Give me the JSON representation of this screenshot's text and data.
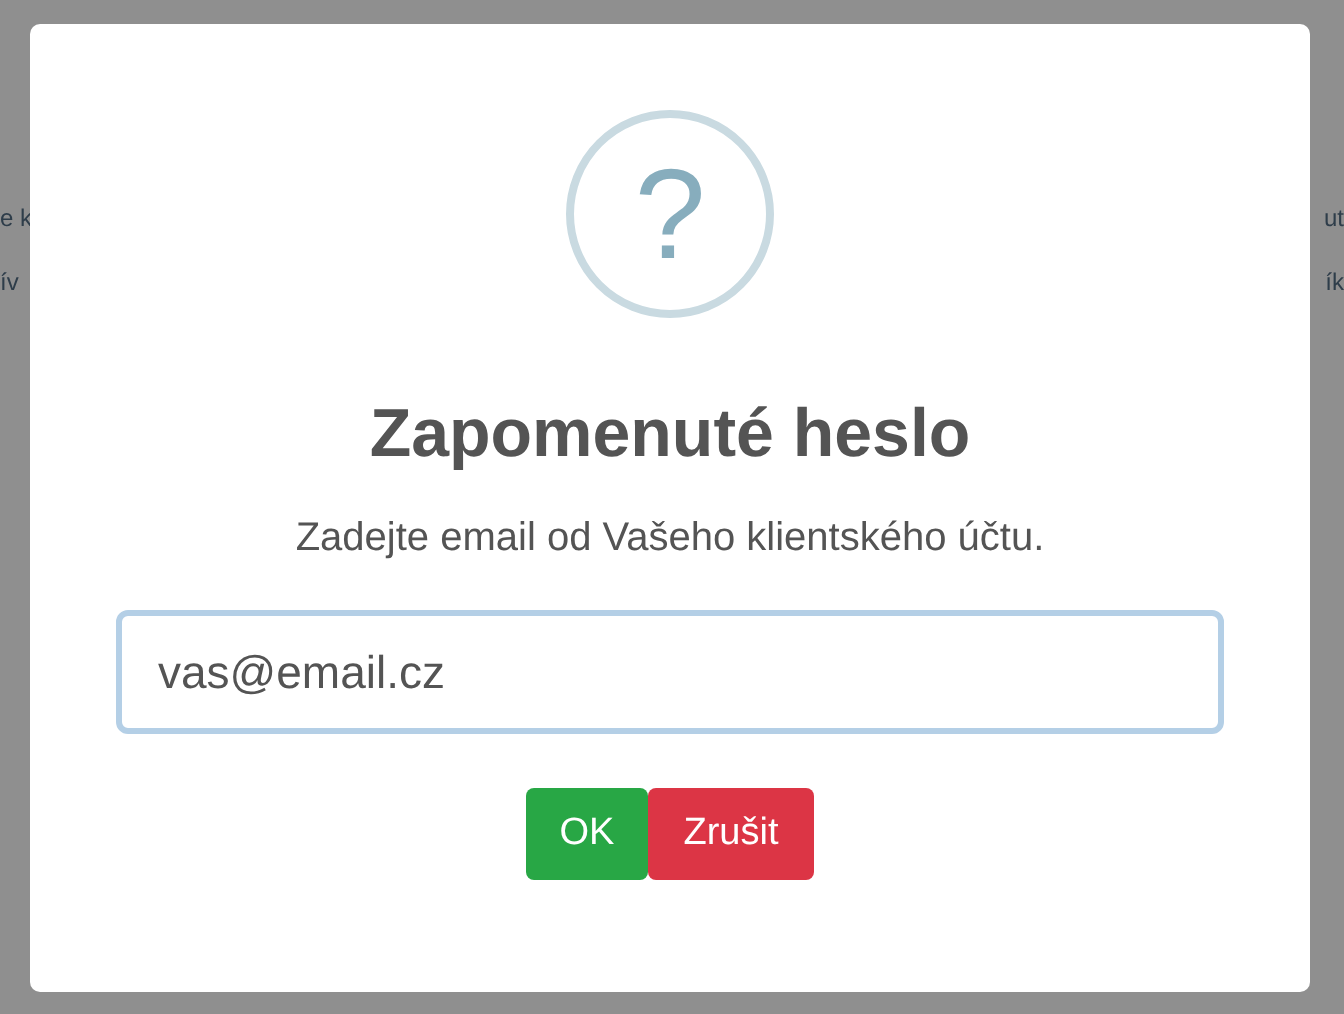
{
  "background": {
    "left_lines": [
      "e k",
      "ív"
    ],
    "right_lines": [
      "ut",
      "ík"
    ]
  },
  "dialog": {
    "icon": "?",
    "title": "Zapomenuté heslo",
    "text": "Zadejte email od Vašeho klientského účtu.",
    "input": {
      "value": "vas@email.cz"
    },
    "buttons": [
      {
        "label": "OK",
        "kind": "confirm"
      },
      {
        "label": "Zrušit",
        "kind": "cancel"
      }
    ]
  }
}
